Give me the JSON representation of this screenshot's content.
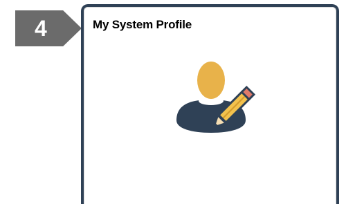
{
  "step": {
    "number": "4",
    "color": "#6b6b6b"
  },
  "tile": {
    "title": "My System Profile",
    "icon": "user-profile-edit-icon",
    "border_color": "#2f4156",
    "accent_color": "#e8b24a"
  }
}
